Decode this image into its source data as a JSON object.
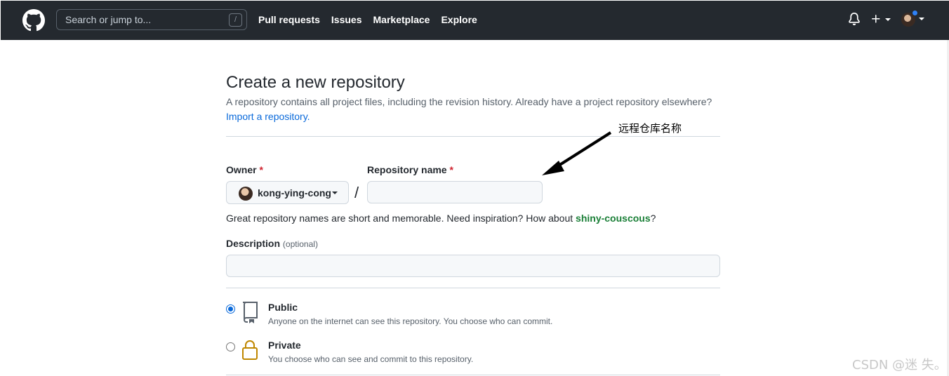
{
  "header": {
    "search_placeholder": "Search or jump to...",
    "search_shortcut": "/",
    "nav": [
      "Pull requests",
      "Issues",
      "Marketplace",
      "Explore"
    ]
  },
  "main": {
    "title": "Create a new repository",
    "subtitle": "A repository contains all project files, including the revision history. Already have a project repository elsewhere?",
    "import_link": "Import a repository.",
    "owner_label": "Owner",
    "owner_required": "*",
    "owner_value": "kong-ying-cong",
    "separator": "/",
    "repo_label": "Repository name",
    "repo_required": "*",
    "repo_value": "",
    "hint_prefix": "Great repository names are short and memorable. Need inspiration? How about ",
    "hint_suggestion": "shiny-couscous",
    "hint_suffix": "?",
    "description_label": "Description",
    "description_optional": "(optional)",
    "description_value": "",
    "visibility": [
      {
        "title": "Public",
        "desc": "Anyone on the internet can see this repository. You choose who can commit.",
        "checked": true
      },
      {
        "title": "Private",
        "desc": "You choose who can see and commit to this repository.",
        "checked": false
      }
    ]
  },
  "annotation": {
    "text": "远程仓库名称"
  },
  "watermark": "CSDN @迷 失。",
  "colors": {
    "header_bg": "#24292f",
    "link": "#0969da",
    "required": "#cf222e",
    "suggestion": "#1a7f37",
    "private_icon": "#bf8700"
  },
  "icons": [
    "github-logo-icon",
    "bell-icon",
    "plus-icon",
    "repo-icon",
    "lock-icon"
  ]
}
